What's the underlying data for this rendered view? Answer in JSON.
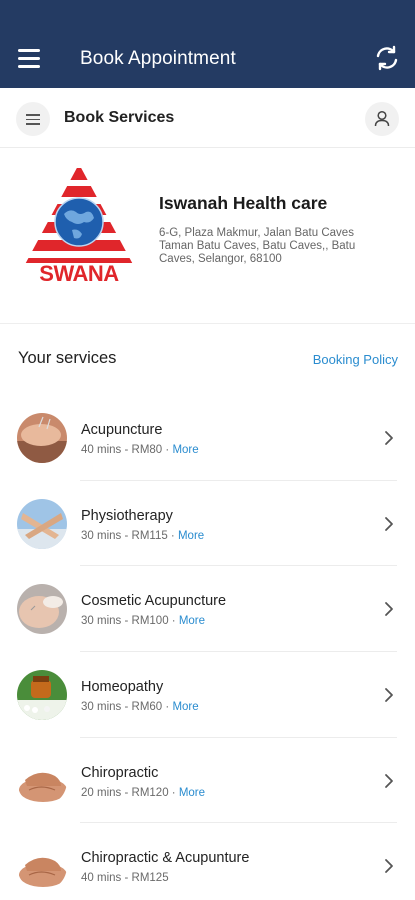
{
  "topbar": {
    "title": "Book Appointment",
    "menu_icon": "menu-icon",
    "refresh_icon": "refresh-icon"
  },
  "subbar": {
    "title": "Book Services",
    "left_icon": "list-icon",
    "right_icon": "user-icon"
  },
  "business": {
    "name": "Iswanah Health care",
    "address": "6-G, Plaza Makmur, Jalan Batu Caves Taman Batu Caves, Batu Caves,, Batu Caves, Selangor, 68100",
    "logo_text": "SWANA"
  },
  "services_header": {
    "title": "Your services",
    "policy_link": "Booking Policy"
  },
  "services": [
    {
      "name": "Acupuncture",
      "duration": "40 mins",
      "price": "RM80",
      "more": "More",
      "thumb": "acupuncture"
    },
    {
      "name": "Physiotherapy",
      "duration": "30 mins",
      "price": "RM115",
      "more": "More",
      "thumb": "physiotherapy"
    },
    {
      "name": "Cosmetic Acupuncture",
      "duration": "30 mins",
      "price": "RM100",
      "more": "More",
      "thumb": "cosmetic"
    },
    {
      "name": "Homeopathy",
      "duration": "30 mins",
      "price": "RM60",
      "more": "More",
      "thumb": "homeopathy"
    },
    {
      "name": "Chiropractic",
      "duration": "20 mins",
      "price": "RM120",
      "more": "More",
      "thumb": "chiropractic"
    },
    {
      "name": "Chiropractic & Acupunture",
      "duration": "40 mins",
      "price": "RM125",
      "more": "",
      "thumb": "chiropractic"
    }
  ],
  "meta_separator": " - ",
  "more_separator": " · ",
  "colors": {
    "header": "#243b63",
    "link": "#2a8ccf",
    "logo_red": "#e0262b",
    "logo_blue": "#1f5fae"
  }
}
